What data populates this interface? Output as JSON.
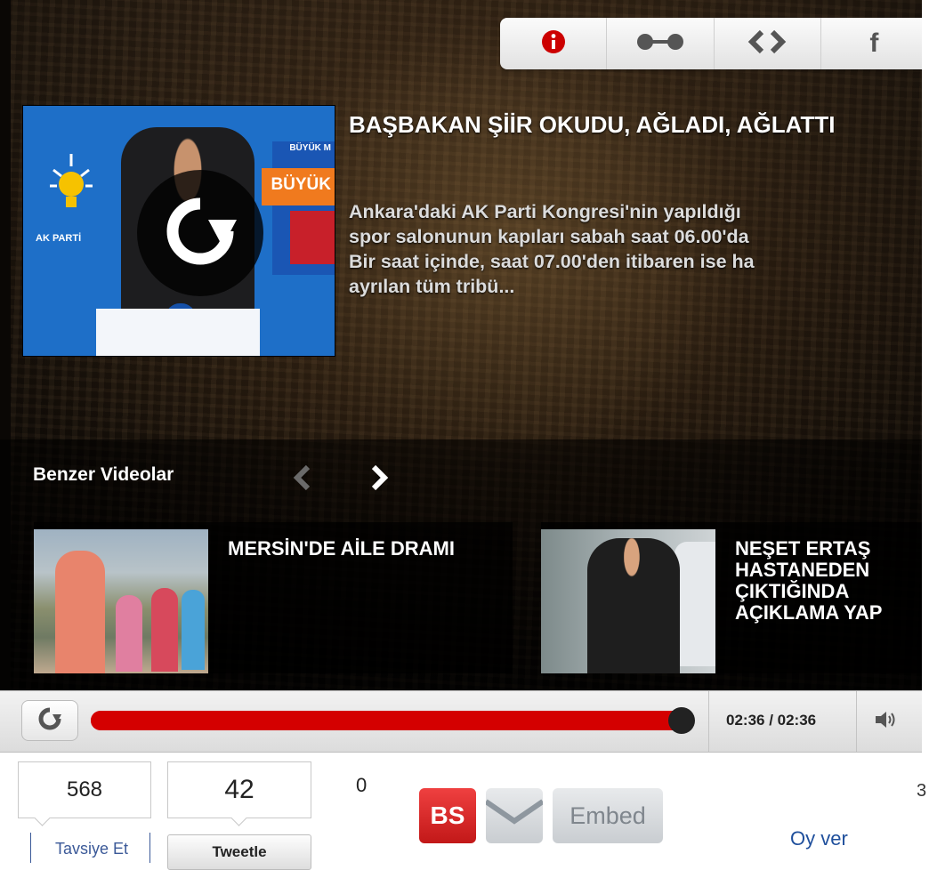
{
  "share_bar": {
    "buttons": [
      {
        "name": "info-icon"
      },
      {
        "name": "link-icon"
      },
      {
        "name": "embed-code-icon"
      },
      {
        "name": "facebook-icon",
        "label": "f"
      }
    ]
  },
  "thumbnail": {
    "party_label": "AK PARTİ",
    "stage_text_small": "BÜYÜK M",
    "stage_text_large": "BÜYÜK"
  },
  "video": {
    "title": "BAŞBAKAN ŞİİR OKUDU, AĞLADI, AĞLATTI",
    "description": "Ankara'daki AK Parti Kongresi'nin yapıldığı\nspor salonunun kapıları sabah saat 06.00'da\nBir saat içinde, saat 07.00'den itibaren ise ha\nayrılan tüm tribü..."
  },
  "related": {
    "heading": "Benzer Videolar",
    "items": [
      {
        "title": "MERSİN'DE AİLE DRAMI"
      },
      {
        "title": "NEŞET ERTAŞ HASTANEDEN ÇIKTIĞINDA AÇIKLAMA YAP"
      }
    ]
  },
  "controls": {
    "time": "02:36 / 02:36",
    "progress": 1.0
  },
  "social": {
    "facebook_count": "568",
    "facebook_label": "Tavsiye Et",
    "tweet_count": "42",
    "tweet_label": "Tweetle",
    "other_count": "0",
    "bs_label": "BS",
    "embed_label": "Embed",
    "vote_label": "Oy ver",
    "clipped_number": "3"
  },
  "colors": {
    "accent_red": "#d40000",
    "facebook_blue": "#3b5998",
    "link_blue": "#1f4f9c"
  }
}
